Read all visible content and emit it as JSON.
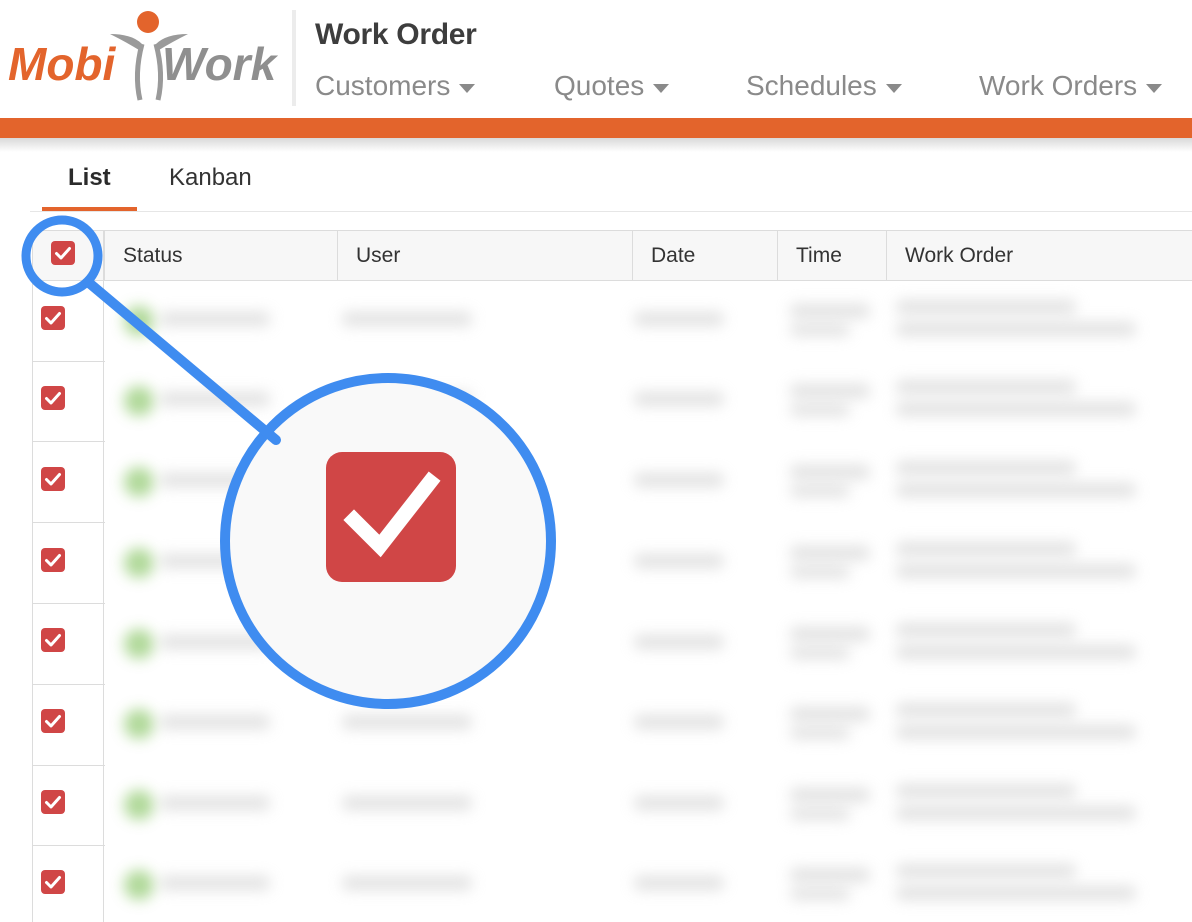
{
  "app": {
    "logo": {
      "part1": "Mobi",
      "part2": "Work"
    },
    "title": "Work Order"
  },
  "nav": [
    {
      "label": "Customers"
    },
    {
      "label": "Quotes"
    },
    {
      "label": "Schedules"
    },
    {
      "label": "Work Orders"
    }
  ],
  "tabs": [
    {
      "label": "List",
      "active": true
    },
    {
      "label": "Kanban",
      "active": false
    }
  ],
  "table": {
    "columns": [
      "Status",
      "User",
      "Date",
      "Time",
      "Work Order"
    ],
    "header_checked": true,
    "row_count": 8,
    "rows_checked": [
      true,
      true,
      true,
      true,
      true,
      true,
      true,
      true
    ]
  },
  "colors": {
    "accent": "#e3642c",
    "checkbox": "#d04646",
    "callout": "#3f8cf0",
    "status_dot": "#9ccf7f"
  },
  "icons": {
    "checkbox": "checkmark-icon",
    "nav_caret": "caret-down-icon"
  }
}
